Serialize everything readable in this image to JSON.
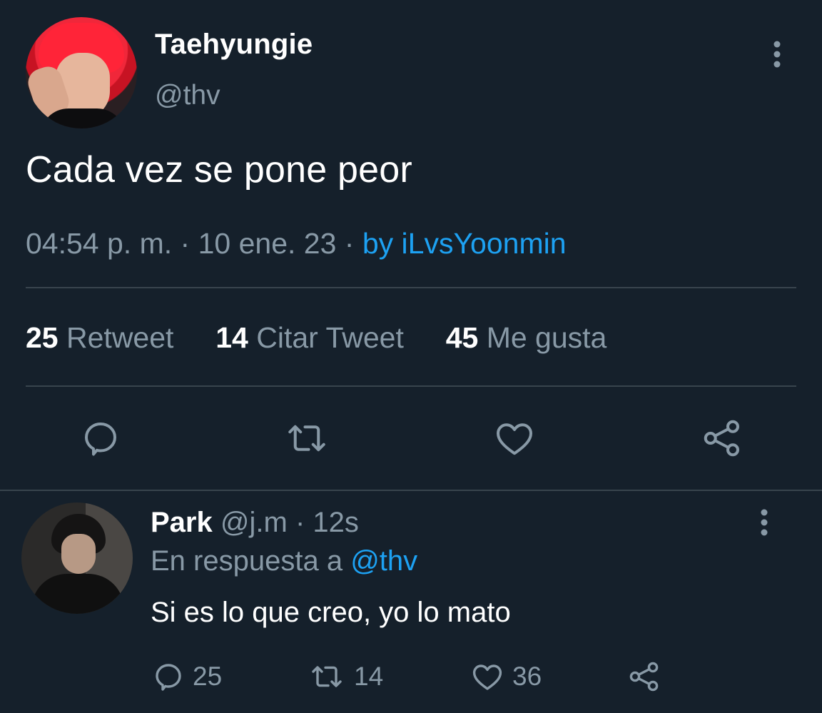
{
  "colors": {
    "background": "#15202b",
    "text_primary": "#ffffff",
    "text_secondary": "#8899a6",
    "accent": "#1da1f2",
    "divider": "#38444d"
  },
  "tweet": {
    "display_name": "Taehyungie",
    "handle": "@thv",
    "text": "Cada vez se pone peor",
    "time": "04:54 p. m.",
    "separator": "·",
    "date": "10 ene. 23",
    "source": "by iLvsYoonmin",
    "stats": {
      "retweets_count": "25",
      "retweets_label": "Retweet",
      "quotes_count": "14",
      "quotes_label": "Citar Tweet",
      "likes_count": "45",
      "likes_label": "Me gusta"
    },
    "actions": {
      "reply_icon": "reply-icon",
      "retweet_icon": "retweet-icon",
      "like_icon": "heart-icon",
      "share_icon": "share-icon"
    }
  },
  "reply": {
    "display_name": "Park",
    "handle": "@j.m",
    "separator": "·",
    "age": "12s",
    "in_reply_to_prefix": "En respuesta a",
    "in_reply_to_handle": "@thv",
    "text": "Si es lo que creo, yo lo mato",
    "counts": {
      "replies": "25",
      "retweets": "14",
      "likes": "36"
    }
  }
}
